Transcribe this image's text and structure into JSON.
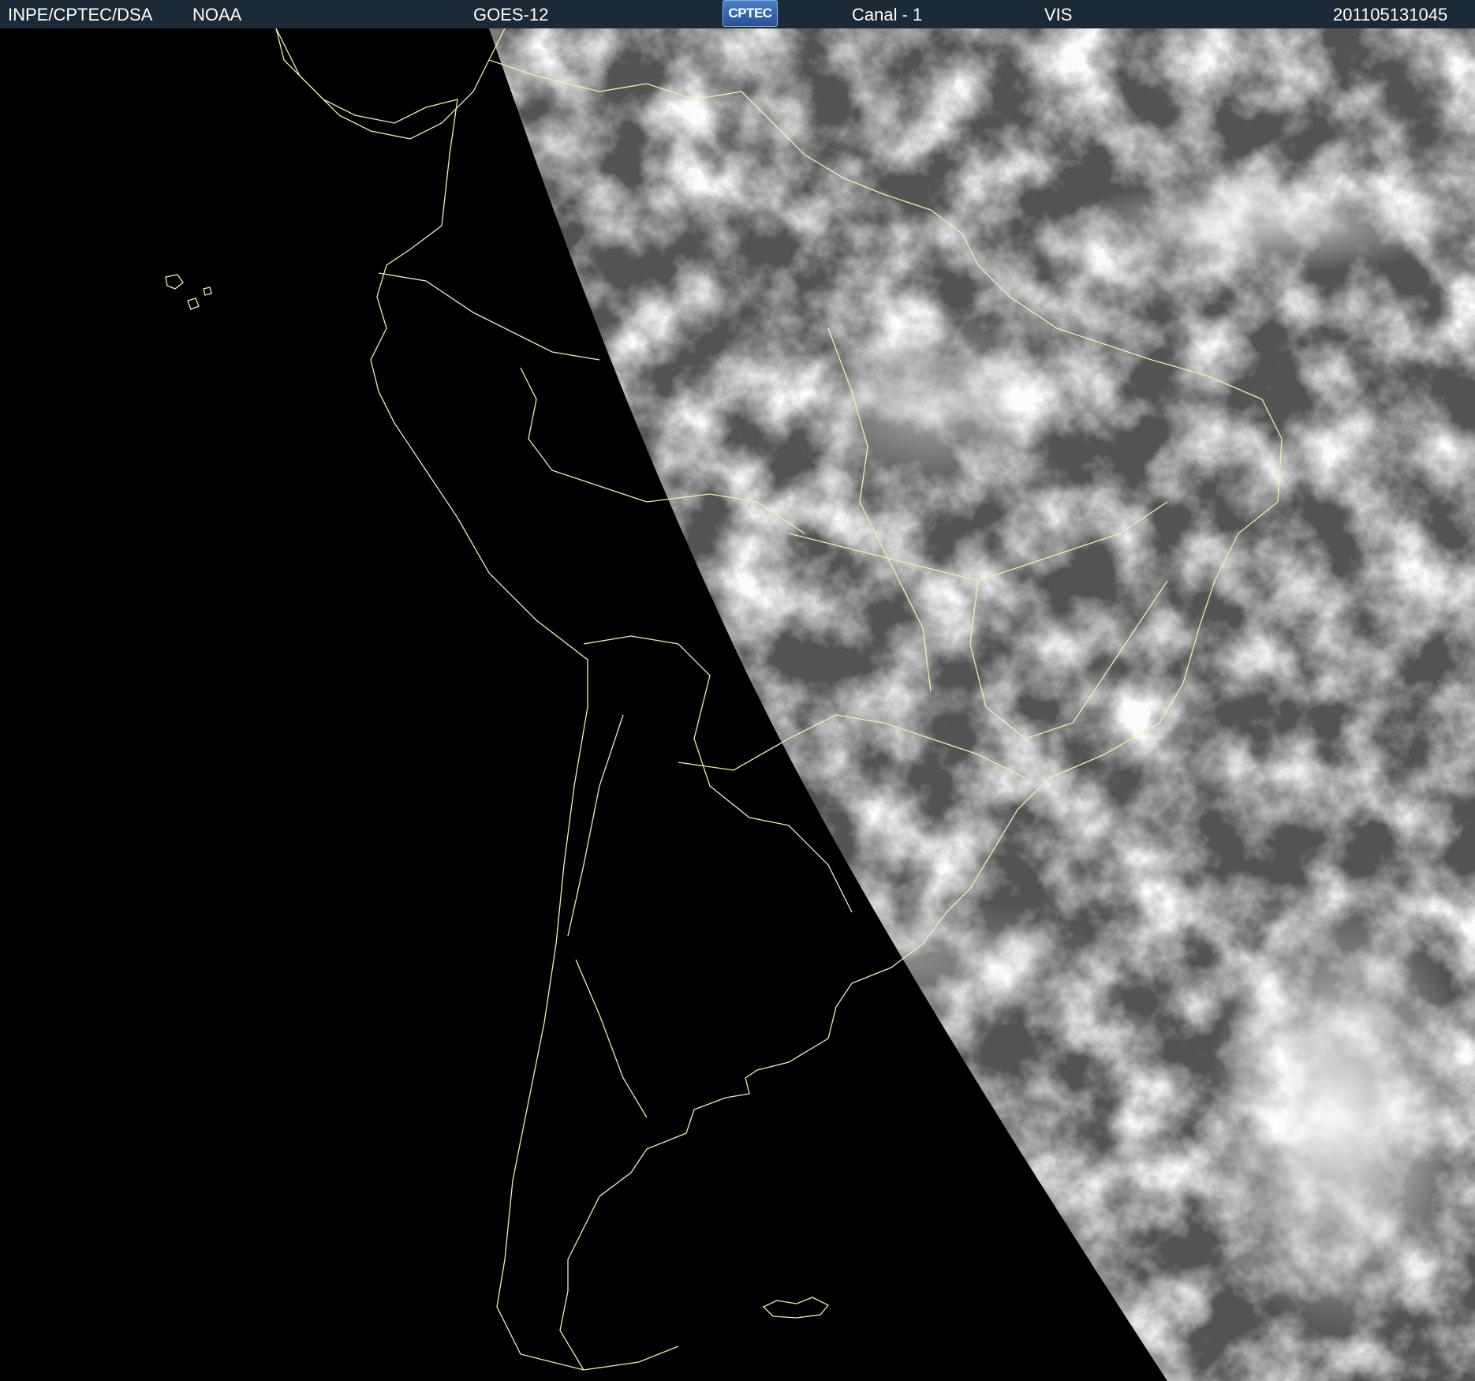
{
  "header": {
    "agency": "INPE/CPTEC/DSA",
    "source": "NOAA",
    "satellite": "GOES-12",
    "logo_text": "CPTEC",
    "channel": "Canal - 1",
    "band": "VIS",
    "timestamp": "201105131045"
  },
  "colors": {
    "header_bg": "#1a2a36",
    "header_text": "#ffffff",
    "space": "#000000",
    "earth_base": "#5a5a5a",
    "cloud": "#e8e8e8",
    "borders": "#f0f0b0"
  },
  "icons": [
    "cptec-logo-icon"
  ]
}
